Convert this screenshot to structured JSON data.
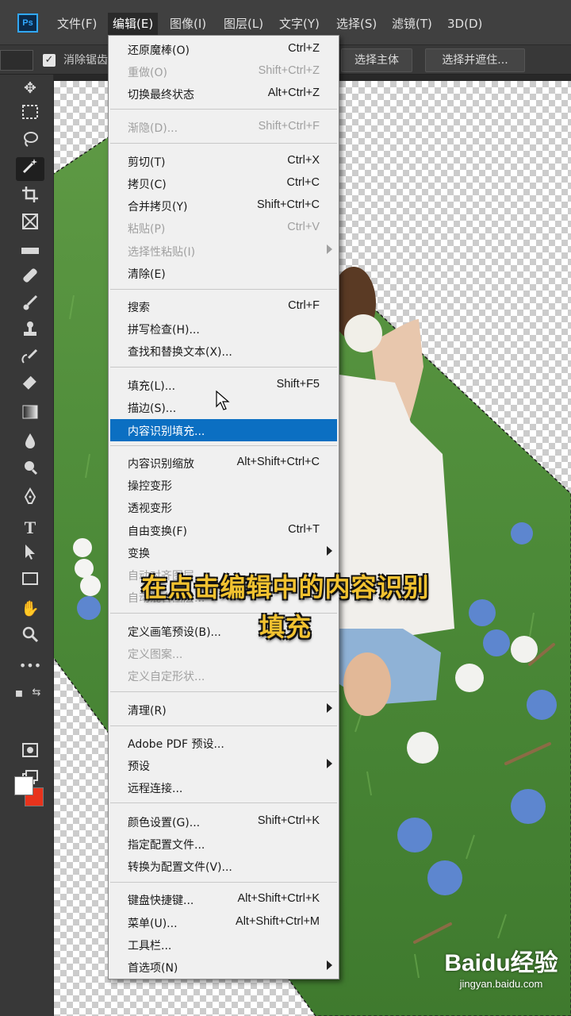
{
  "app": {
    "logo": "Ps"
  },
  "menubar": {
    "items": [
      {
        "label": "文件(F)"
      },
      {
        "label": "编辑(E)"
      },
      {
        "label": "图像(I)"
      },
      {
        "label": "图层(L)"
      },
      {
        "label": "文字(Y)"
      },
      {
        "label": "选择(S)"
      },
      {
        "label": "滤镜(T)"
      },
      {
        "label": "3D(D)"
      }
    ]
  },
  "options": {
    "partial_label": "消除锯齿",
    "select_subject_button": "选择主体",
    "select_and_mask_button": "选择并遮住..."
  },
  "toolbar": {
    "tools": [
      "move-tool-icon",
      "marquee-tool-icon",
      "lasso-tool-icon",
      "magic-wand-tool-icon",
      "crop-tool-icon",
      "frame-tool-icon",
      "eyedropper-tool-icon",
      "healing-brush-tool-icon",
      "brush-tool-icon",
      "clone-stamp-tool-icon",
      "history-brush-tool-icon",
      "eraser-tool-icon",
      "gradient-tool-icon",
      "blur-tool-icon",
      "dodge-tool-icon",
      "pen-tool-icon",
      "type-tool-icon",
      "path-selection-tool-icon",
      "rectangle-tool-icon",
      "hand-tool-icon",
      "zoom-tool-icon",
      "more-tools-icon"
    ],
    "foreground_color": "#ffffff",
    "background_color": "#e8331c"
  },
  "edit_menu": {
    "items": [
      {
        "label": "还原魔棒(O)",
        "shortcut": "Ctrl+Z"
      },
      {
        "label": "重做(O)",
        "shortcut": "Shift+Ctrl+Z"
      },
      {
        "label": "切换最终状态",
        "shortcut": "Alt+Ctrl+Z"
      },
      {
        "label": "渐隐(D)...",
        "shortcut": "Shift+Ctrl+F"
      },
      {
        "label": "剪切(T)",
        "shortcut": "Ctrl+X"
      },
      {
        "label": "拷贝(C)",
        "shortcut": "Ctrl+C"
      },
      {
        "label": "合并拷贝(Y)",
        "shortcut": "Shift+Ctrl+C"
      },
      {
        "label": "粘贴(P)",
        "shortcut": "Ctrl+V"
      },
      {
        "label": "选择性粘贴(I)",
        "shortcut": ""
      },
      {
        "label": "清除(E)",
        "shortcut": ""
      },
      {
        "label": "搜索",
        "shortcut": "Ctrl+F"
      },
      {
        "label": "拼写检查(H)...",
        "shortcut": ""
      },
      {
        "label": "查找和替换文本(X)...",
        "shortcut": ""
      },
      {
        "label": "填充(L)...",
        "shortcut": "Shift+F5"
      },
      {
        "label": "描边(S)...",
        "shortcut": ""
      },
      {
        "label": "内容识别填充...",
        "shortcut": ""
      },
      {
        "label": "内容识别缩放",
        "shortcut": "Alt+Shift+Ctrl+C"
      },
      {
        "label": "操控变形",
        "shortcut": ""
      },
      {
        "label": "透视变形",
        "shortcut": ""
      },
      {
        "label": "自由变换(F)",
        "shortcut": "Ctrl+T"
      },
      {
        "label": "变换",
        "shortcut": ""
      },
      {
        "label": "自动对齐图层...",
        "shortcut": ""
      },
      {
        "label": "自动混合图层...",
        "shortcut": ""
      },
      {
        "label": "定义画笔预设(B)...",
        "shortcut": ""
      },
      {
        "label": "定义图案...",
        "shortcut": ""
      },
      {
        "label": "定义自定形状...",
        "shortcut": ""
      },
      {
        "label": "清理(R)",
        "shortcut": ""
      },
      {
        "label": "Adobe PDF 预设...",
        "shortcut": ""
      },
      {
        "label": "预设",
        "shortcut": ""
      },
      {
        "label": "远程连接...",
        "shortcut": ""
      },
      {
        "label": "颜色设置(G)...",
        "shortcut": "Shift+Ctrl+K"
      },
      {
        "label": "指定配置文件...",
        "shortcut": ""
      },
      {
        "label": "转换为配置文件(V)...",
        "shortcut": ""
      },
      {
        "label": "键盘快捷键...",
        "shortcut": "Alt+Shift+Ctrl+K"
      },
      {
        "label": "菜单(U)...",
        "shortcut": "Alt+Shift+Ctrl+M"
      },
      {
        "label": "工具栏...",
        "shortcut": ""
      },
      {
        "label": "首选项(N)",
        "shortcut": ""
      }
    ]
  },
  "caption": {
    "line1": "在点击编辑中的内容识别",
    "line2": "填充"
  },
  "watermark": {
    "brand": "Baidu经验",
    "url": "jingyan.baidu.com"
  },
  "colors": {
    "highlight": "#0b6fc2",
    "caption": "#f2c230"
  }
}
